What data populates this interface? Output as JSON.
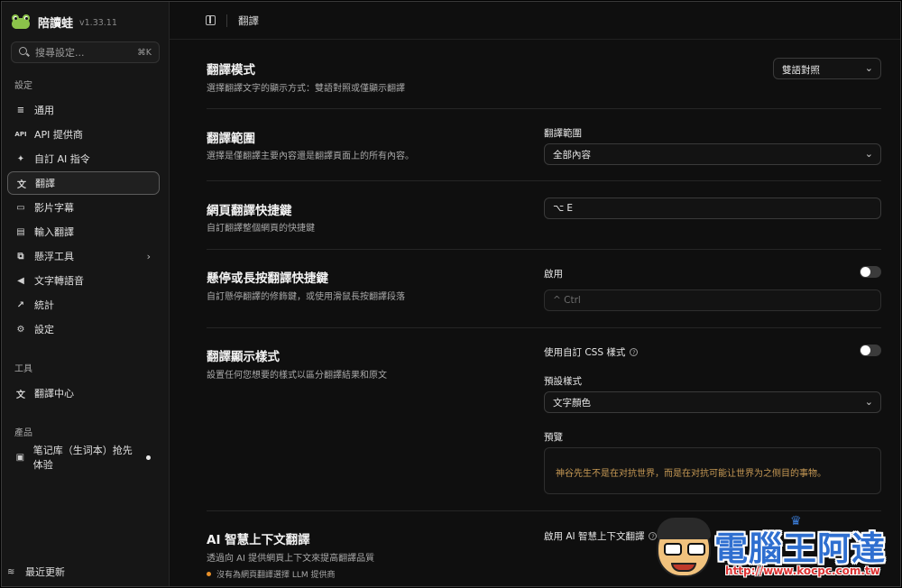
{
  "app": {
    "name": "陪讀蛙",
    "version": "v1.33.11"
  },
  "search": {
    "placeholder": "搜尋設定...",
    "shortcut": "⌘K"
  },
  "sidebar": {
    "section_settings": "設定",
    "items": [
      {
        "icon": "sliders-icon",
        "glyph": "≡",
        "label": "通用"
      },
      {
        "icon": "api-icon",
        "glyph": "API",
        "label": "API 提供商"
      },
      {
        "icon": "sparkle-icon",
        "glyph": "✦",
        "label": "自訂 AI 指令"
      },
      {
        "icon": "translate-icon",
        "glyph": "文",
        "label": "翻譯"
      },
      {
        "icon": "subtitle-icon",
        "glyph": "▭",
        "label": "影片字幕"
      },
      {
        "icon": "input-icon",
        "glyph": "▤",
        "label": "輸入翻譯"
      },
      {
        "icon": "float-icon",
        "glyph": "⧉",
        "label": "懸浮工具"
      },
      {
        "icon": "megaphone-icon",
        "glyph": "◀",
        "label": "文字轉語音"
      },
      {
        "icon": "chart-icon",
        "glyph": "↗",
        "label": "統計"
      },
      {
        "icon": "gear-icon",
        "glyph": "⚙",
        "label": "設定"
      }
    ],
    "section_tools": "工具",
    "tools": [
      {
        "icon": "translate-icon",
        "glyph": "文",
        "label": "翻譯中心"
      }
    ],
    "section_products": "產品",
    "products": [
      {
        "icon": "notebook-icon",
        "glyph": "▣",
        "label": "笔记库（生词本）抢先体验"
      }
    ],
    "footer": {
      "icon": "rss-icon",
      "glyph": "≋",
      "label": "最近更新"
    }
  },
  "topbar": {
    "title": "翻譯"
  },
  "settings": {
    "mode": {
      "title": "翻譯模式",
      "desc": "選擇翻譯文字的顯示方式：雙語對照或僅顯示翻譯",
      "value": "雙語對照"
    },
    "range": {
      "title": "翻譯範圍",
      "desc": "選擇是僅翻譯主要內容還是翻譯頁面上的所有內容。",
      "label": "翻譯範圍",
      "value": "全部內容"
    },
    "shortcut": {
      "title": "網頁翻譯快捷鍵",
      "desc": "自訂翻譯整個網頁的快捷鍵",
      "value": "⌥ E"
    },
    "hover": {
      "title": "懸停或長按翻譯快捷鍵",
      "desc": "自訂懸停翻譯的修飾鍵，或使用滑鼠長按翻譯段落",
      "enable_label": "啟用",
      "enabled": false,
      "value": "^ Ctrl"
    },
    "style": {
      "title": "翻譯顯示樣式",
      "desc": "設置任何您想要的樣式以區分翻譯結果和原文",
      "custom_css_label": "使用自訂 CSS 樣式",
      "custom_css": false,
      "preset_label": "預設樣式",
      "preset_value": "文字顏色",
      "preview_label": "預覽",
      "preview_text": "神谷先生不是在对抗世界，而是在对抗可能让世界为之侧目的事物。"
    },
    "ai_context": {
      "title": "AI 智慧上下文翻譯",
      "desc": "透過向 AI 提供網頁上下文來提高翻譯品質",
      "warning": "沒有為網頁翻譯選擇 LLM 提供商",
      "enable_label": "啟用 AI 智慧上下文翻譯"
    }
  },
  "watermark": {
    "text": "電腦王阿達",
    "url": "http://www.kocpc.com.tw"
  },
  "colors": {
    "accent_preview": "#c89a55",
    "warning_dot": "#e8902a"
  }
}
